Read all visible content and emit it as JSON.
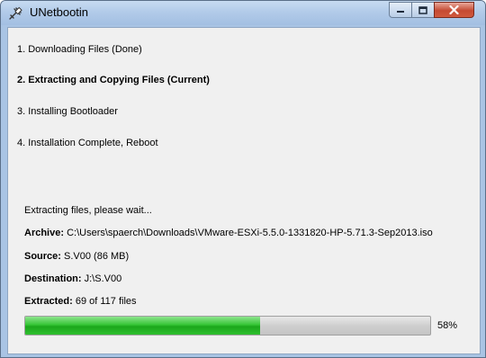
{
  "window": {
    "title": "UNetbootin",
    "icon": "unetbootin-app-icon",
    "controls": {
      "minimize": "minimize-icon",
      "maximize": "maximize-icon",
      "close": "close-icon"
    }
  },
  "steps": [
    {
      "label": "1. Downloading Files (Done)",
      "current": false
    },
    {
      "label": "2. Extracting and Copying Files (Current)",
      "current": true
    },
    {
      "label": "3. Installing Bootloader",
      "current": false
    },
    {
      "label": "4. Installation Complete, Reboot",
      "current": false
    }
  ],
  "status": {
    "message": "Extracting files, please wait...",
    "archive_label": "Archive:",
    "archive_value": "C:\\Users\\spaerch\\Downloads\\VMware-ESXi-5.5.0-1331820-HP-5.71.3-Sep2013.iso",
    "source_label": "Source:",
    "source_value": "S.V00 (86 MB)",
    "destination_label": "Destination:",
    "destination_value": "J:\\S.V00",
    "extracted_label": "Extracted:",
    "extracted_value": "69 of 117 files"
  },
  "progress": {
    "percent": 58,
    "percent_text": "58%",
    "fill_color": "#2fc02f"
  }
}
